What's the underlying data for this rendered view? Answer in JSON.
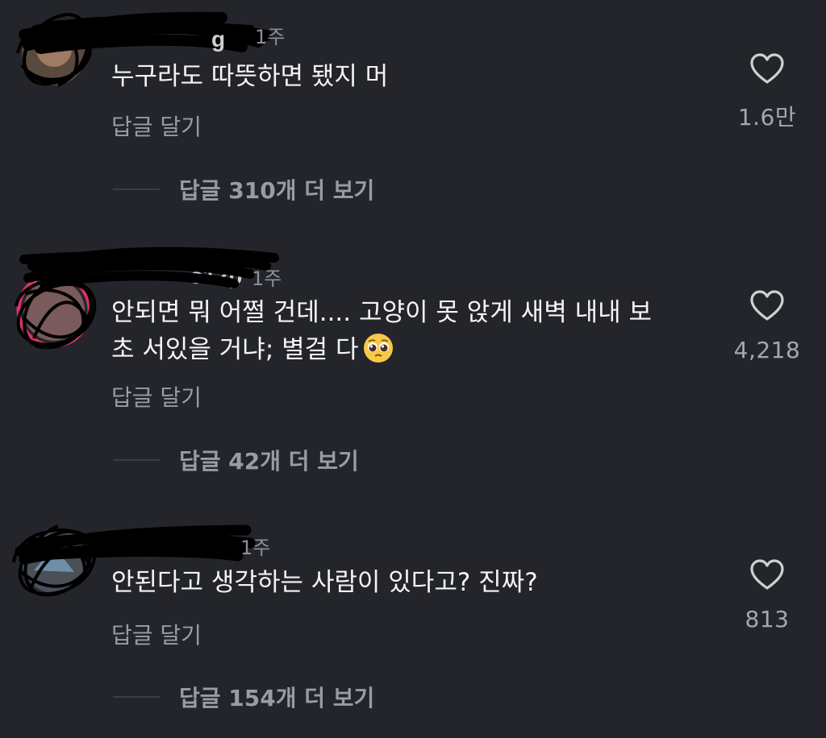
{
  "comments": [
    {
      "username_visible": "g",
      "time": "1주",
      "text": "누구라도 따뜻하면 됐지 머",
      "reply_label": "답글 달기",
      "like_count": "1.6만",
      "more_replies": "답글 310개 더 보기"
    },
    {
      "username_visible": "o12p",
      "time": "1주",
      "text_line1": "안되면 뭐 어쩔 건데.... 고양이 못 앉게 새벽 내내 보",
      "text_line2": "초 서있을 거냐; 별걸 다",
      "emoji": "pleading-face-emoji",
      "reply_label": "답글 달기",
      "like_count": "4,218",
      "more_replies": "답글 42개 더 보기"
    },
    {
      "username_visible": "",
      "time": "1주",
      "text": "안된다고 생각하는 사람이 있다고? 진짜?",
      "reply_label": "답글 달기",
      "like_count": "813",
      "more_replies": "답글 154개 더 보기"
    }
  ],
  "icons": {
    "like": "heart-outline-icon"
  },
  "colors": {
    "background": "#23252b",
    "text_primary": "#f4f4f4",
    "text_secondary": "#9a9ca3"
  }
}
